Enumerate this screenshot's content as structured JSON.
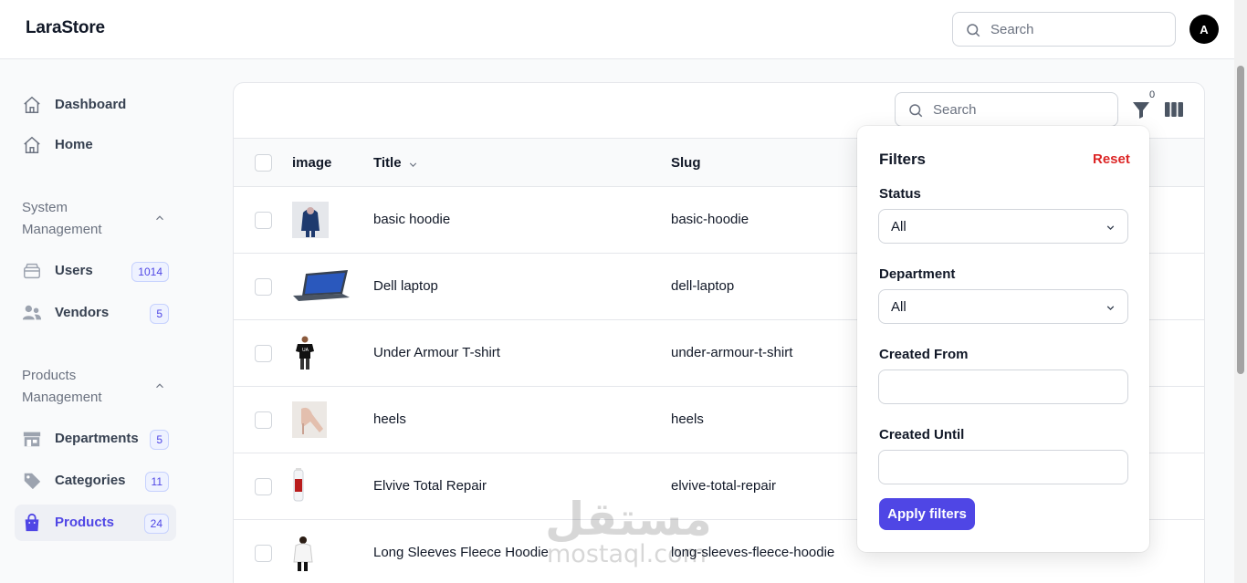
{
  "app": {
    "brand": "LaraStore"
  },
  "header": {
    "search_placeholder": "Search",
    "avatar_initial": "A"
  },
  "sidebar": {
    "dashboard": "Dashboard",
    "home": "Home",
    "system_group": [
      "System",
      "Management"
    ],
    "users": {
      "label": "Users",
      "badge": "1014"
    },
    "vendors": {
      "label": "Vendors",
      "badge": "5"
    },
    "products_group": [
      "Products",
      "Management"
    ],
    "departments": {
      "label": "Departments",
      "badge": "5"
    },
    "categories": {
      "label": "Categories",
      "badge": "11"
    },
    "products": {
      "label": "Products",
      "badge": "24"
    }
  },
  "table": {
    "search_placeholder": "Search",
    "filter_count": "0",
    "columns": {
      "image": "image",
      "title": "Title",
      "slug": "Slug"
    },
    "rows": [
      {
        "title": "basic hoodie",
        "slug": "basic-hoodie",
        "image": "hoodie"
      },
      {
        "title": "Dell laptop",
        "slug": "dell-laptop",
        "image": "laptop"
      },
      {
        "title": "Under Armour T-shirt",
        "slug": "under-armour-t-shirt",
        "image": "tshirt"
      },
      {
        "title": "heels",
        "slug": "heels",
        "image": "heels"
      },
      {
        "title": "Elvive Total Repair",
        "slug": "elvive-total-repair",
        "image": "bottle"
      },
      {
        "title": "Long Sleeves Fleece Hoodie",
        "slug": "long-sleeves-fleece-hoodie",
        "image": "fleece"
      }
    ]
  },
  "filters": {
    "title": "Filters",
    "reset": "Reset",
    "status_label": "Status",
    "status_value": "All",
    "department_label": "Department",
    "department_value": "All",
    "created_from_label": "Created From",
    "created_until_label": "Created Until",
    "apply": "Apply filters"
  },
  "watermark": {
    "arabic": "مستقل",
    "latin": "mostaql.com"
  },
  "colors": {
    "primary": "#4f46e5",
    "danger": "#dc2626"
  }
}
